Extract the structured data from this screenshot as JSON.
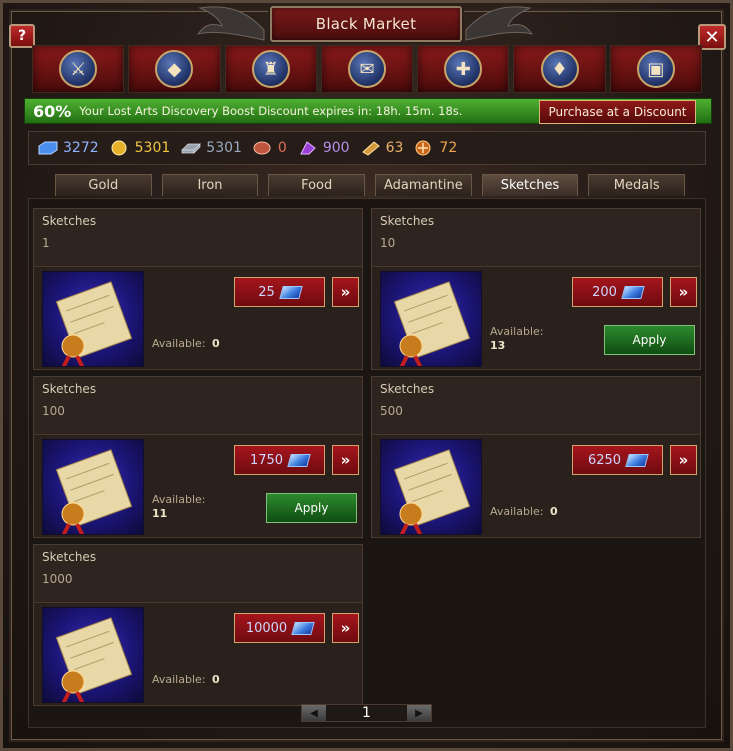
{
  "window": {
    "title": "Black Market",
    "help_label": "?",
    "close_label": "✕"
  },
  "categories": [
    {
      "name": "military"
    },
    {
      "name": "resources"
    },
    {
      "name": "knights"
    },
    {
      "name": "scrolls"
    },
    {
      "name": "healing"
    },
    {
      "name": "gems"
    },
    {
      "name": "chests"
    }
  ],
  "discount": {
    "percent": "60%",
    "text": "Your Lost Arts Discovery Boost Discount expires in: 18h. 15m. 18s.",
    "button_label": "Purchase at a Discount"
  },
  "resources": [
    {
      "name": "gems",
      "value": "3272",
      "color": "#8fb4ff"
    },
    {
      "name": "gold",
      "value": "5301",
      "color": "#f0c541"
    },
    {
      "name": "iron",
      "value": "5301",
      "color": "#9aa9c0"
    },
    {
      "name": "food",
      "value": "0",
      "color": "#e06d5c"
    },
    {
      "name": "adamantine",
      "value": "900",
      "color": "#b48ee6"
    },
    {
      "name": "sketches",
      "value": "63",
      "color": "#e8b36a"
    },
    {
      "name": "medals",
      "value": "72",
      "color": "#f0a650"
    }
  ],
  "tabs": [
    {
      "label": "Gold"
    },
    {
      "label": "Iron"
    },
    {
      "label": "Food"
    },
    {
      "label": "Adamantine"
    },
    {
      "label": "Sketches",
      "active": true
    },
    {
      "label": "Medals"
    }
  ],
  "cards": [
    {
      "name": "Sketches",
      "qty": "1",
      "price": "25",
      "available_label": "Available:",
      "available": "0",
      "apply": false
    },
    {
      "name": "Sketches",
      "qty": "10",
      "price": "200",
      "available_label": "Available:",
      "available": "13",
      "apply": true,
      "apply_label": "Apply"
    },
    {
      "name": "Sketches",
      "qty": "100",
      "price": "1750",
      "available_label": "Available:",
      "available": "11",
      "apply": true,
      "apply_label": "Apply"
    },
    {
      "name": "Sketches",
      "qty": "500",
      "price": "6250",
      "available_label": "Available:",
      "available": "0",
      "apply": false
    },
    {
      "name": "Sketches",
      "qty": "1000",
      "price": "10000",
      "available_label": "Available:",
      "available": "0",
      "apply": false
    }
  ],
  "card_more_label": "»",
  "pager": {
    "prev": "◀",
    "page": "1",
    "next": "▶"
  }
}
